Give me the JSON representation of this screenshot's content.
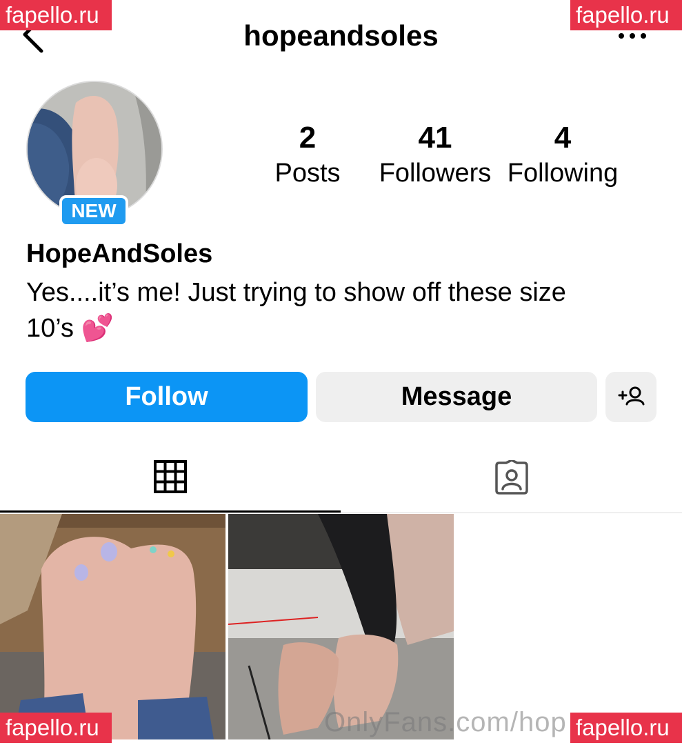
{
  "header": {
    "username": "hopeandsoles",
    "back_icon": "chevron-left-icon",
    "more_icon": "more-horizontal-icon"
  },
  "watermarks": {
    "top_left": "fapello.ru",
    "top_right": "fapello.ru",
    "bottom_left": "fapello.ru",
    "bottom_right": "fapello.ru"
  },
  "profile": {
    "badge": "NEW",
    "display_name": "HopeAndSoles",
    "bio_line1": "Yes....it’s me! Just trying to show off these size",
    "bio_line2": "10’s",
    "bio_emoji": "💕"
  },
  "stats": [
    {
      "value": "2",
      "label": "Posts"
    },
    {
      "value": "41",
      "label": "Followers"
    },
    {
      "value": "4",
      "label": "Following"
    }
  ],
  "actions": {
    "follow_label": "Follow",
    "message_label": "Message",
    "suggest_icon": "add-person-icon"
  },
  "tabs": [
    {
      "icon": "grid-icon",
      "active": true
    },
    {
      "icon": "tagged-person-icon",
      "active": false
    }
  ],
  "overlay": {
    "text": "OnlyFans.com/hop"
  },
  "colors": {
    "follow_button": "#0c95f5",
    "badge": "#1f9bf0",
    "watermark": "#e8334a",
    "secondary_button": "#efefef"
  }
}
